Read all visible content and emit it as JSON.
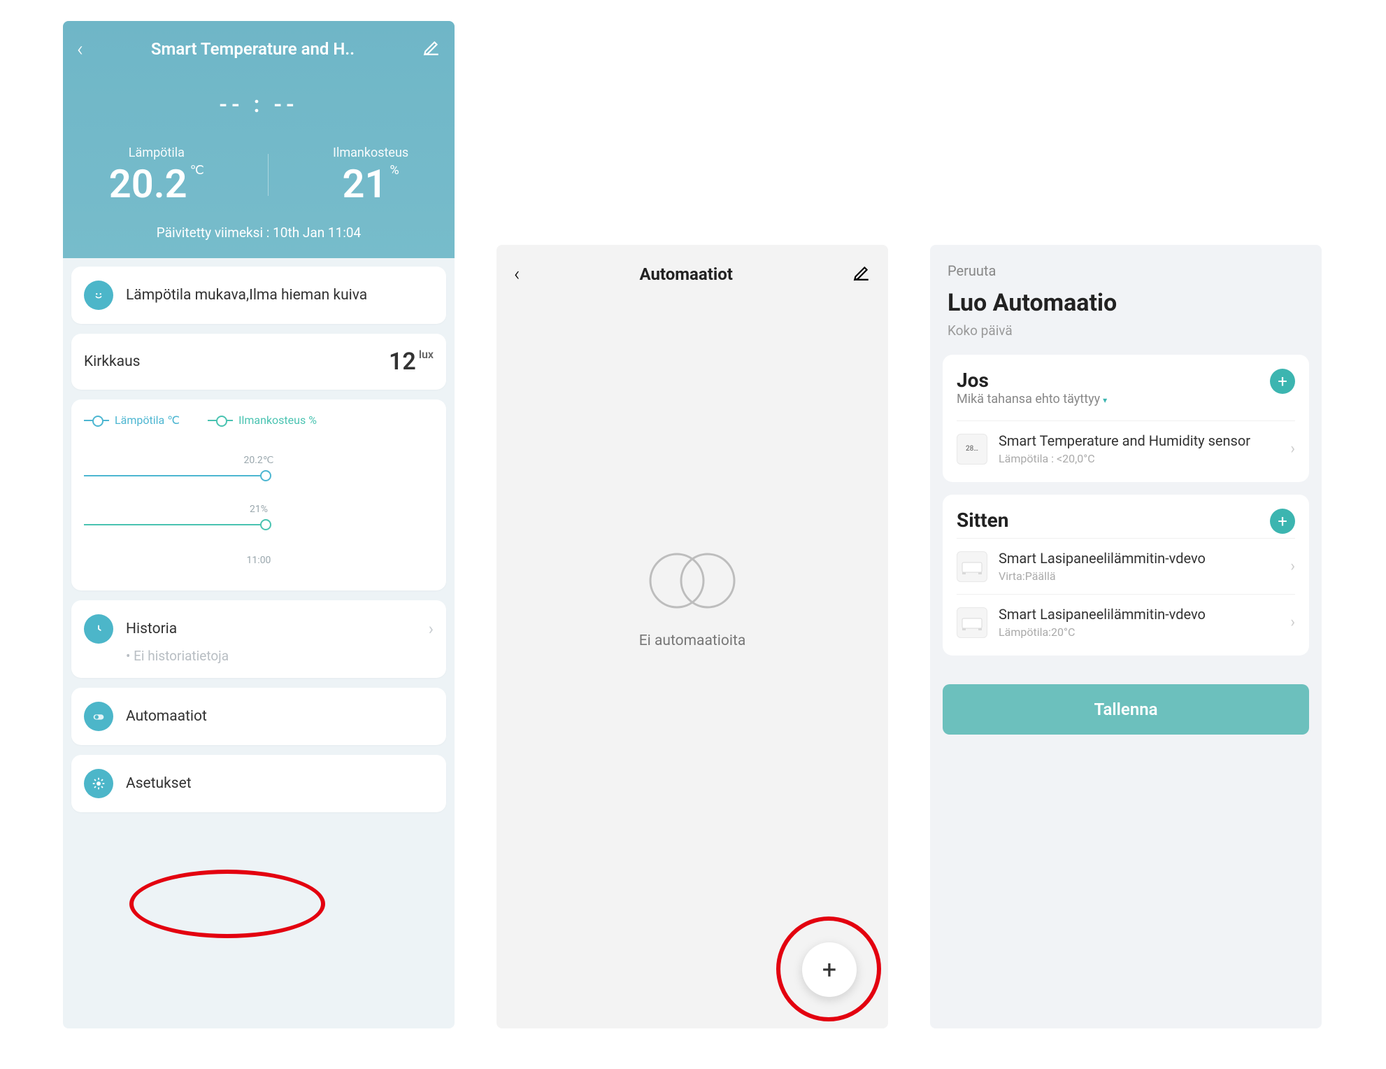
{
  "phone1": {
    "title": "Smart Temperature and H..",
    "time_display": "-- : --",
    "temperature": {
      "label": "Lämpötila",
      "value": "20.2",
      "unit": "℃"
    },
    "humidity": {
      "label": "Ilmankosteus",
      "value": "21",
      "unit": "%"
    },
    "updated": {
      "prefix": "Päivitetty viimeksi : ",
      "value": "10th Jan 11:04"
    },
    "comfort_status": "Lämpötila mukava,Ilma hieman kuiva",
    "brightness": {
      "label": "Kirkkaus",
      "value": "12",
      "unit": "lux"
    },
    "chart": {
      "legend_temp": "Lämpötila ℃",
      "legend_hum": "Ilmankosteus %",
      "temp_marker": "20.2℃",
      "hum_marker": "21%",
      "time_marker": "11:00"
    },
    "history": {
      "label": "Historia",
      "empty": "Ei historiatietoja"
    },
    "automations_label": "Automaatiot",
    "settings_label": "Asetukset"
  },
  "phone2": {
    "title": "Automaatiot",
    "empty_message": "Ei automaatioita"
  },
  "phone3": {
    "cancel": "Peruuta",
    "title": "Luo Automaatio",
    "subtitle": "Koko päivä",
    "if_section": {
      "title": "Jos",
      "dropdown": "Mikä tahansa ehto täyttyy",
      "items": [
        {
          "icon_text": "28…",
          "name": "Smart Temperature and Humidity sensor",
          "sub": "Lämpötila : <20,0°C"
        }
      ]
    },
    "then_section": {
      "title": "Sitten",
      "items": [
        {
          "name": "Smart Lasipaneelilämmitin-vdevo",
          "sub": "Virta:Päällä"
        },
        {
          "name": "Smart Lasipaneelilämmitin-vdevo",
          "sub": "Lämpötila:20°C"
        }
      ]
    },
    "save": "Tallenna"
  }
}
